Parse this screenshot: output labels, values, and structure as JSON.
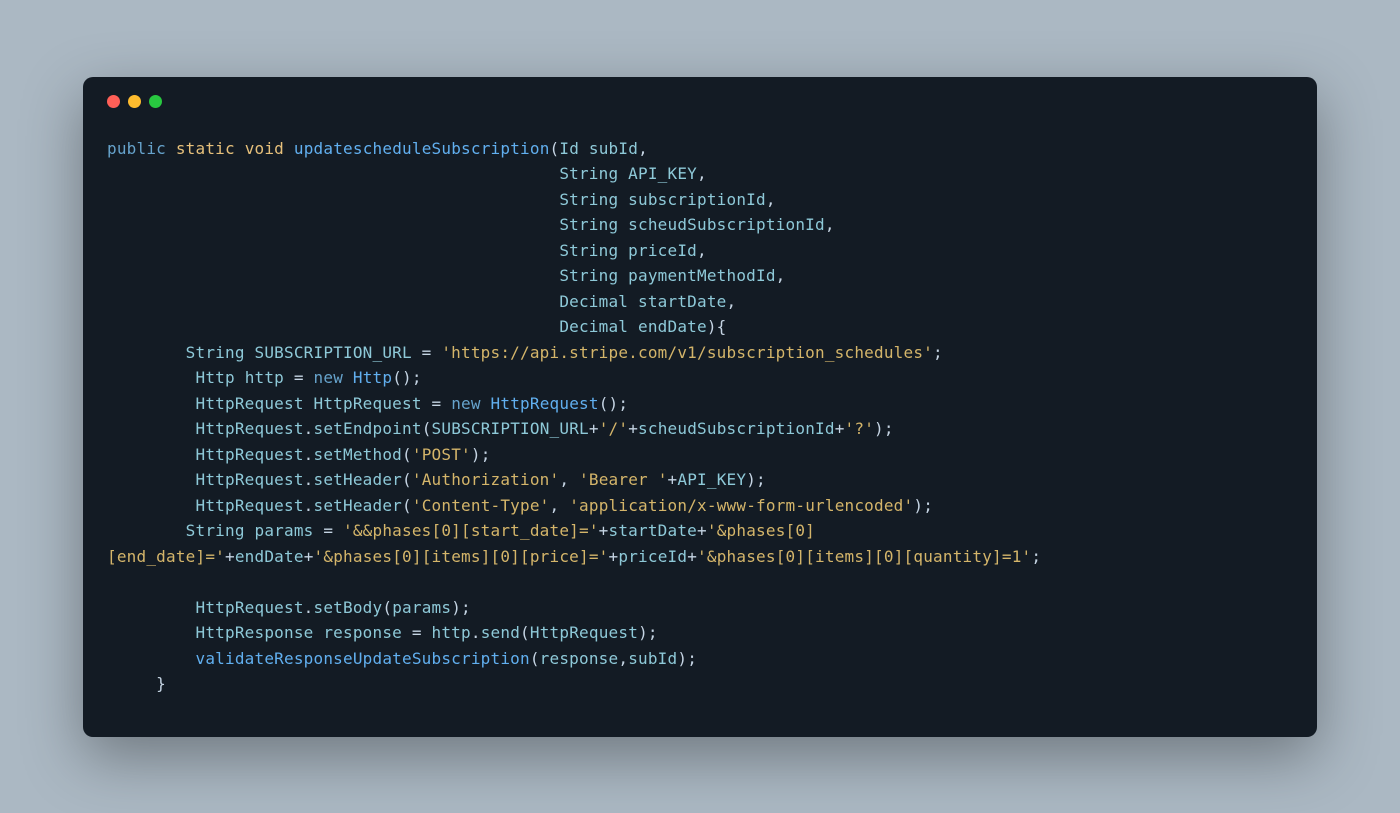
{
  "code": {
    "kw_public": "public",
    "kw_static": "static",
    "kw_void": "void",
    "fn_name": "updatescheduleSubscription",
    "param1_type": "Id",
    "param1_name": "subId",
    "param2_type": "String",
    "param2_name": "API_KEY",
    "param3_type": "String",
    "param3_name": "subscriptionId",
    "param4_type": "String",
    "param4_name": "scheudSubscriptionId",
    "param5_type": "String",
    "param5_name": "priceId",
    "param6_type": "String",
    "param6_name": "paymentMethodId",
    "param7_type": "Decimal",
    "param7_name": "startDate",
    "param8_type": "Decimal",
    "param8_name": "endDate",
    "var_suburl_type": "String",
    "var_suburl_name": "SUBSCRIPTION_URL",
    "str_suburl": "'https://api.stripe.com/v1/subscription_schedules'",
    "http_type": "Http",
    "http_name": "http",
    "kw_new": "new",
    "http_ctor": "Http",
    "httpreq_type": "HttpRequest",
    "httpreq_name": "HttpRequest",
    "httpreq_ctor": "HttpRequest",
    "setEndpoint": "setEndpoint",
    "str_slash": "'/'",
    "str_qmark": "'?'",
    "setMethod": "setMethod",
    "str_post": "'POST'",
    "setHeader": "setHeader",
    "str_auth": "'Authorization'",
    "str_bearer": "'Bearer '",
    "str_ct_key": "'Content-Type'",
    "str_ct_val": "'application/x-www-form-urlencoded'",
    "params_type": "String",
    "params_name": "params",
    "str_params1": "'&&phases[0][start_date]='",
    "str_params2": "'&phases[0]\n[end_date]='",
    "str_params2a": "'&phases[0]",
    "str_params2b": "[end_date]='",
    "str_params3": "'&phases[0][items][0][price]='",
    "str_params4": "'&phases[0][items][0][quantity]=1'",
    "setBody": "setBody",
    "httpres_type": "HttpResponse",
    "httpres_name": "response",
    "send": "send",
    "validate_fn": "validateResponseUpdateSubscription"
  }
}
